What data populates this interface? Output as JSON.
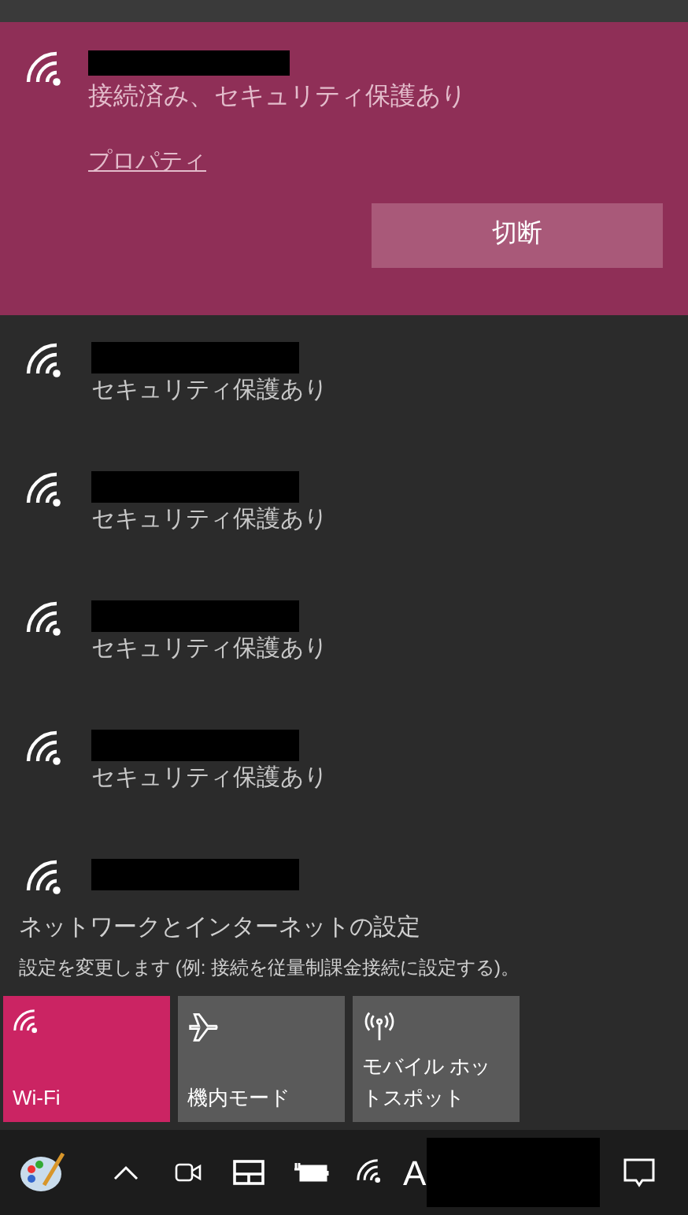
{
  "connected_network": {
    "status": "接続済み、セキュリティ保護あり",
    "properties_link": "プロパティ",
    "disconnect_button": "切断",
    "selected": true
  },
  "networks": [
    {
      "kind": "full",
      "status": "セキュリティ保護あり"
    },
    {
      "kind": "full",
      "status": "セキュリティ保護あり"
    },
    {
      "kind": "full",
      "status": "セキュリティ保護あり"
    },
    {
      "kind": "full",
      "status": "セキュリティ保護あり"
    },
    {
      "kind": "cut_off"
    }
  ],
  "settings": {
    "title": "ネットワークとインターネットの設定",
    "subtitle": "設定を変更します (例: 接続を従量制課金接続に設定する)。"
  },
  "quick_actions": [
    {
      "kind": "wifi",
      "label": "Wi-Fi",
      "on": true
    },
    {
      "kind": "airplane",
      "label": "機内モード",
      "on": false
    },
    {
      "kind": "hotspot",
      "label": "モバイル ホットスポット",
      "on": false
    }
  ],
  "taskbar": {
    "input_indicator": "A"
  }
}
